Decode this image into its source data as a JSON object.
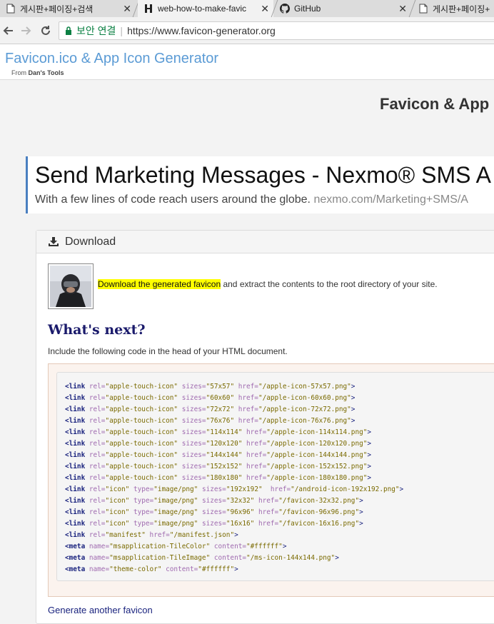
{
  "browser": {
    "tabs": [
      {
        "title": "게시판+페이징+검색",
        "icon": "page-icon"
      },
      {
        "title": "web-how-to-make-favic",
        "icon": "h-logo-icon"
      },
      {
        "title": "GitHub",
        "icon": "github-icon"
      },
      {
        "title": "게시판+페이징+",
        "icon": "page-icon"
      }
    ],
    "close_glyph": "✕",
    "security_label": "보안 연결",
    "url": "https://www.favicon-generator.org"
  },
  "site": {
    "title": "Favicon.ico & App Icon Generator",
    "sub_prefix": "From ",
    "sub_brand": "Dan's Tools",
    "page_heading": "Favicon & App"
  },
  "ad": {
    "title": "Send Marketing Messages - Nexmo® SMS A",
    "desc": "With a few lines of code reach users around the globe.",
    "url": "nexmo.com/Marketing+SMS/A"
  },
  "download": {
    "header": "Download",
    "link_text": "Download the generated favicon",
    "rest_text": " and extract the contents to the root directory of your site.",
    "whats_next": "What's next?",
    "include_text": "Include the following code in the head of your HTML document.",
    "another_link": "Generate another favicon"
  },
  "code_lines": [
    [
      [
        "<link ",
        "tag"
      ],
      [
        "rel=",
        "attr"
      ],
      [
        "\"apple-touch-icon\" ",
        "val"
      ],
      [
        "sizes=",
        "attr"
      ],
      [
        "\"57x57\" ",
        "val"
      ],
      [
        "href=",
        "attr"
      ],
      [
        "\"/apple-icon-57x57.png\"",
        "val"
      ],
      [
        ">",
        "pl"
      ]
    ],
    [
      [
        "<link ",
        "tag"
      ],
      [
        "rel=",
        "attr"
      ],
      [
        "\"apple-touch-icon\" ",
        "val"
      ],
      [
        "sizes=",
        "attr"
      ],
      [
        "\"60x60\" ",
        "val"
      ],
      [
        "href=",
        "attr"
      ],
      [
        "\"/apple-icon-60x60.png\"",
        "val"
      ],
      [
        ">",
        "pl"
      ]
    ],
    [
      [
        "<link ",
        "tag"
      ],
      [
        "rel=",
        "attr"
      ],
      [
        "\"apple-touch-icon\" ",
        "val"
      ],
      [
        "sizes=",
        "attr"
      ],
      [
        "\"72x72\" ",
        "val"
      ],
      [
        "href=",
        "attr"
      ],
      [
        "\"/apple-icon-72x72.png\"",
        "val"
      ],
      [
        ">",
        "pl"
      ]
    ],
    [
      [
        "<link ",
        "tag"
      ],
      [
        "rel=",
        "attr"
      ],
      [
        "\"apple-touch-icon\" ",
        "val"
      ],
      [
        "sizes=",
        "attr"
      ],
      [
        "\"76x76\" ",
        "val"
      ],
      [
        "href=",
        "attr"
      ],
      [
        "\"/apple-icon-76x76.png\"",
        "val"
      ],
      [
        ">",
        "pl"
      ]
    ],
    [
      [
        "<link ",
        "tag"
      ],
      [
        "rel=",
        "attr"
      ],
      [
        "\"apple-touch-icon\" ",
        "val"
      ],
      [
        "sizes=",
        "attr"
      ],
      [
        "\"114x114\" ",
        "val"
      ],
      [
        "href=",
        "attr"
      ],
      [
        "\"/apple-icon-114x114.png\"",
        "val"
      ],
      [
        ">",
        "pl"
      ]
    ],
    [
      [
        "<link ",
        "tag"
      ],
      [
        "rel=",
        "attr"
      ],
      [
        "\"apple-touch-icon\" ",
        "val"
      ],
      [
        "sizes=",
        "attr"
      ],
      [
        "\"120x120\" ",
        "val"
      ],
      [
        "href=",
        "attr"
      ],
      [
        "\"/apple-icon-120x120.png\"",
        "val"
      ],
      [
        ">",
        "pl"
      ]
    ],
    [
      [
        "<link ",
        "tag"
      ],
      [
        "rel=",
        "attr"
      ],
      [
        "\"apple-touch-icon\" ",
        "val"
      ],
      [
        "sizes=",
        "attr"
      ],
      [
        "\"144x144\" ",
        "val"
      ],
      [
        "href=",
        "attr"
      ],
      [
        "\"/apple-icon-144x144.png\"",
        "val"
      ],
      [
        ">",
        "pl"
      ]
    ],
    [
      [
        "<link ",
        "tag"
      ],
      [
        "rel=",
        "attr"
      ],
      [
        "\"apple-touch-icon\" ",
        "val"
      ],
      [
        "sizes=",
        "attr"
      ],
      [
        "\"152x152\" ",
        "val"
      ],
      [
        "href=",
        "attr"
      ],
      [
        "\"/apple-icon-152x152.png\"",
        "val"
      ],
      [
        ">",
        "pl"
      ]
    ],
    [
      [
        "<link ",
        "tag"
      ],
      [
        "rel=",
        "attr"
      ],
      [
        "\"apple-touch-icon\" ",
        "val"
      ],
      [
        "sizes=",
        "attr"
      ],
      [
        "\"180x180\" ",
        "val"
      ],
      [
        "href=",
        "attr"
      ],
      [
        "\"/apple-icon-180x180.png\"",
        "val"
      ],
      [
        ">",
        "pl"
      ]
    ],
    [
      [
        "<link ",
        "tag"
      ],
      [
        "rel=",
        "attr"
      ],
      [
        "\"icon\" ",
        "val"
      ],
      [
        "type=",
        "attr"
      ],
      [
        "\"image/png\" ",
        "val"
      ],
      [
        "sizes=",
        "attr"
      ],
      [
        "\"192x192\"  ",
        "val"
      ],
      [
        "href=",
        "attr"
      ],
      [
        "\"/android-icon-192x192.png\"",
        "val"
      ],
      [
        ">",
        "pl"
      ]
    ],
    [
      [
        "<link ",
        "tag"
      ],
      [
        "rel=",
        "attr"
      ],
      [
        "\"icon\" ",
        "val"
      ],
      [
        "type=",
        "attr"
      ],
      [
        "\"image/png\" ",
        "val"
      ],
      [
        "sizes=",
        "attr"
      ],
      [
        "\"32x32\" ",
        "val"
      ],
      [
        "href=",
        "attr"
      ],
      [
        "\"/favicon-32x32.png\"",
        "val"
      ],
      [
        ">",
        "pl"
      ]
    ],
    [
      [
        "<link ",
        "tag"
      ],
      [
        "rel=",
        "attr"
      ],
      [
        "\"icon\" ",
        "val"
      ],
      [
        "type=",
        "attr"
      ],
      [
        "\"image/png\" ",
        "val"
      ],
      [
        "sizes=",
        "attr"
      ],
      [
        "\"96x96\" ",
        "val"
      ],
      [
        "href=",
        "attr"
      ],
      [
        "\"/favicon-96x96.png\"",
        "val"
      ],
      [
        ">",
        "pl"
      ]
    ],
    [
      [
        "<link ",
        "tag"
      ],
      [
        "rel=",
        "attr"
      ],
      [
        "\"icon\" ",
        "val"
      ],
      [
        "type=",
        "attr"
      ],
      [
        "\"image/png\" ",
        "val"
      ],
      [
        "sizes=",
        "attr"
      ],
      [
        "\"16x16\" ",
        "val"
      ],
      [
        "href=",
        "attr"
      ],
      [
        "\"/favicon-16x16.png\"",
        "val"
      ],
      [
        ">",
        "pl"
      ]
    ],
    [
      [
        "<link ",
        "tag"
      ],
      [
        "rel=",
        "attr"
      ],
      [
        "\"manifest\" ",
        "val"
      ],
      [
        "href=",
        "attr"
      ],
      [
        "\"/manifest.json\"",
        "val"
      ],
      [
        ">",
        "pl"
      ]
    ],
    [
      [
        "<meta ",
        "tag"
      ],
      [
        "name=",
        "attr"
      ],
      [
        "\"msapplication-TileColor\" ",
        "val"
      ],
      [
        "content=",
        "attr"
      ],
      [
        "\"#ffffff\"",
        "val"
      ],
      [
        ">",
        "pl"
      ]
    ],
    [
      [
        "<meta ",
        "tag"
      ],
      [
        "name=",
        "attr"
      ],
      [
        "\"msapplication-TileImage\" ",
        "val"
      ],
      [
        "content=",
        "attr"
      ],
      [
        "\"/ms-icon-144x144.png\"",
        "val"
      ],
      [
        ">",
        "pl"
      ]
    ],
    [
      [
        "<meta ",
        "tag"
      ],
      [
        "name=",
        "attr"
      ],
      [
        "\"theme-color\" ",
        "val"
      ],
      [
        "content=",
        "attr"
      ],
      [
        "\"#ffffff\"",
        "val"
      ],
      [
        ">",
        "pl"
      ]
    ]
  ]
}
